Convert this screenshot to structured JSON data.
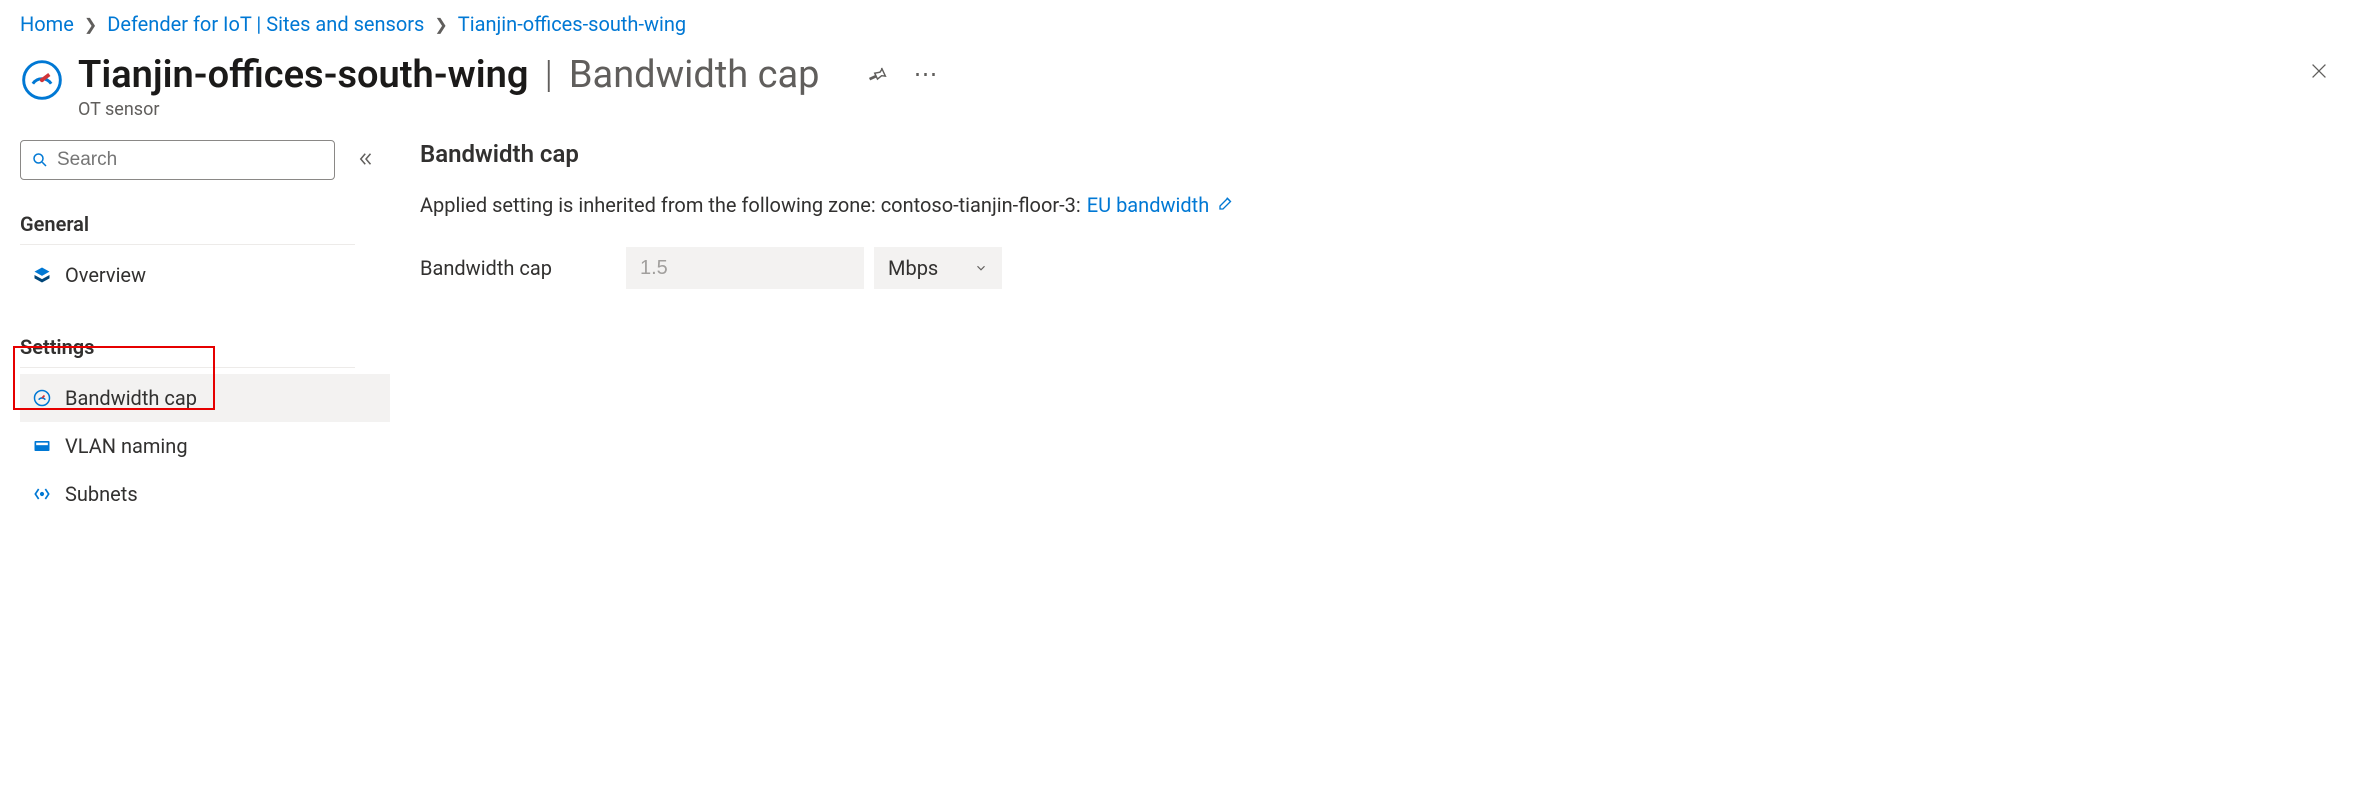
{
  "breadcrumb": {
    "home": "Home",
    "level1": "Defender for IoT | Sites and sensors",
    "current": "Tianjin-offices-south-wing"
  },
  "header": {
    "title_main": "Tianjin-offices-south-wing",
    "title_sub": "Bandwidth cap",
    "subtitle": "OT sensor"
  },
  "sidebar": {
    "search_placeholder": "Search",
    "groups": {
      "general": {
        "label": "General",
        "overview": "Overview"
      },
      "settings": {
        "label": "Settings",
        "bandwidth_cap": "Bandwidth cap",
        "vlan_naming": "VLAN naming",
        "subnets": "Subnets"
      }
    }
  },
  "main": {
    "section_title": "Bandwidth cap",
    "inherit_prefix": "Applied setting is inherited from the following zone: contoso-tianjin-floor-3:",
    "inherit_link": "EU bandwidth",
    "form": {
      "label": "Bandwidth cap",
      "value": "1.5",
      "unit": "Mbps"
    }
  }
}
